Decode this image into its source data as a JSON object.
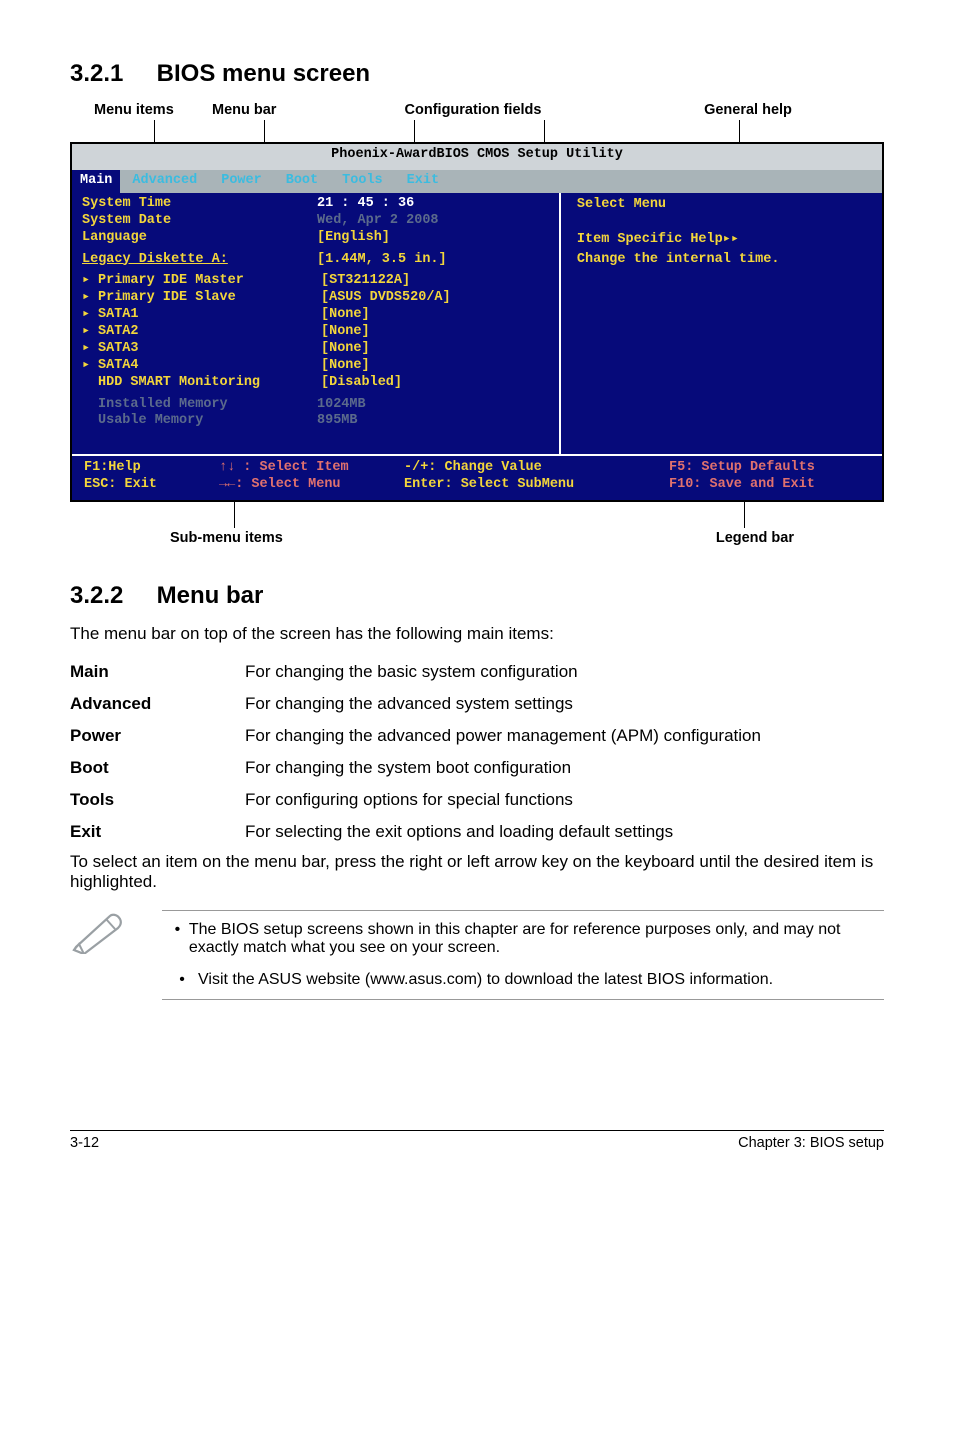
{
  "section1": {
    "num": "3.2.1",
    "title": "BIOS menu screen"
  },
  "callouts": {
    "menu_items": "Menu items",
    "menu_bar": "Menu bar",
    "config": "Configuration fields",
    "help": "General help",
    "sub": "Sub-menu items",
    "legend": "Legend bar"
  },
  "bios": {
    "title": "Phoenix-AwardBIOS CMOS Setup Utility",
    "tabs": [
      "Main",
      "Advanced",
      "Power",
      "Boot",
      "Tools",
      "Exit"
    ],
    "rows": [
      {
        "label": "System Time",
        "value": "21 : 45 : 36"
      },
      {
        "label": "System Date",
        "value": "Wed, Apr  2 2008"
      },
      {
        "label": "Language",
        "value": "    [English]"
      },
      {
        "label": "Legacy Diskette A:",
        "value": "    [1.44M, 3.5 in.]"
      }
    ],
    "submenu": [
      {
        "label": "Primary IDE Master",
        "value": "[ST321122A]"
      },
      {
        "label": "Primary IDE Slave",
        "value": "[ASUS DVDS520/A]"
      },
      {
        "label": "SATA1",
        "value": "[None]"
      },
      {
        "label": "SATA2",
        "value": "[None]"
      },
      {
        "label": "SATA3",
        "value": "[None]"
      },
      {
        "label": "SATA4",
        "value": "[None]"
      },
      {
        "label": "HDD SMART Monitoring",
        "value": "[Disabled]"
      }
    ],
    "mem": [
      {
        "label": "Installed Memory",
        "value": "1024MB"
      },
      {
        "label": "Usable Memory",
        "value": " 895MB"
      }
    ],
    "help_box": {
      "title": "Select Menu",
      "specific": "Item Specific Help▸▸",
      "body": "Change the internal time."
    },
    "legend": {
      "c1a": "F1:Help",
      "c1b": "ESC: Exit",
      "c2a": "↑↓ : Select Item",
      "c2b": "→←: Select Menu",
      "c3a": "-/+: Change Value",
      "c3b": "Enter: Select SubMenu",
      "c4a": "F5: Setup Defaults",
      "c4b": "F10: Save and Exit"
    }
  },
  "section2": {
    "num": "3.2.2",
    "title": "Menu bar"
  },
  "intro": "The menu bar on top of the screen has the following main items:",
  "menu_table": [
    {
      "k": "Main",
      "v": "For changing the basic system configuration"
    },
    {
      "k": "Advanced",
      "v": "For changing the advanced system settings"
    },
    {
      "k": "Power",
      "v": "For changing the advanced power management (APM) configuration"
    },
    {
      "k": "Boot",
      "v": "For changing the system boot configuration"
    },
    {
      "k": "Tools",
      "v": "For configuring options for special functions"
    },
    {
      "k": "Exit",
      "v": "For selecting the exit options and loading default settings"
    }
  ],
  "after": "To select an item on the menu bar, press the right or left arrow key on the keyboard until the desired item is highlighted.",
  "notes": [
    "The BIOS setup screens shown in this chapter are for reference purposes only, and may not exactly match what you see on your screen.",
    "Visit the ASUS website (www.asus.com) to download the latest BIOS information."
  ],
  "footer": {
    "left": "3-12",
    "right": "Chapter 3: BIOS setup"
  }
}
